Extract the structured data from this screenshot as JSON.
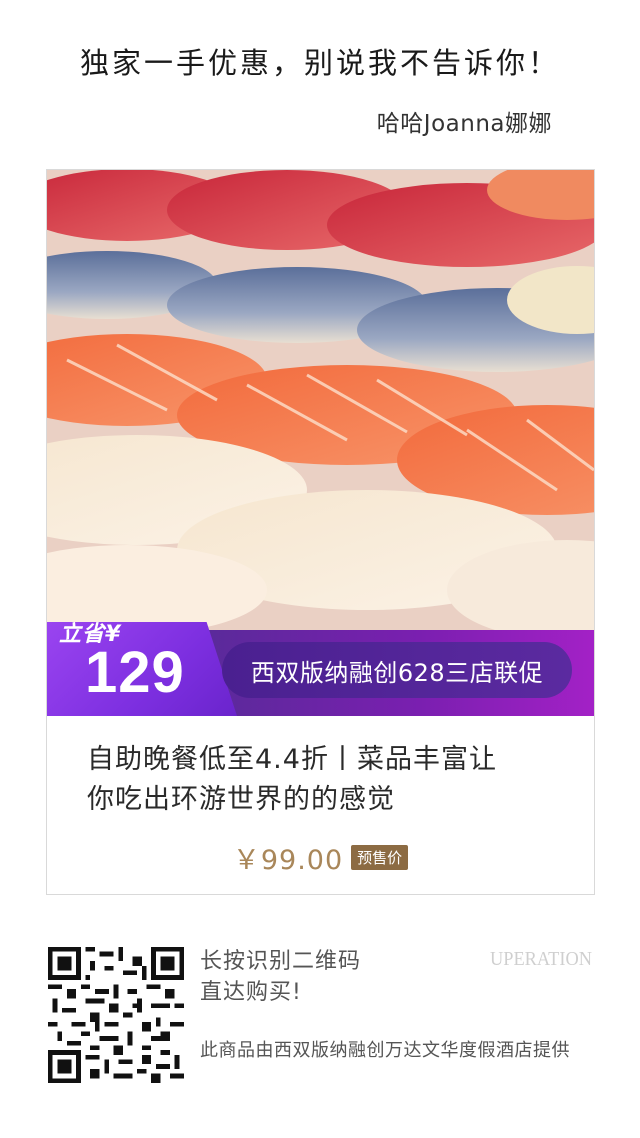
{
  "headline": "独家一手优惠，别说我不告诉你！",
  "author": "哈哈Joanna娜娜",
  "promo": {
    "save_label": "立省¥",
    "save_amount": "129",
    "title": "西双版纳融创628三店联促"
  },
  "product": {
    "title_line1": "自助晚餐低至4.4折丨菜品丰富让",
    "title_line2": "你吃出环游世界的的感觉",
    "price": "￥99.00",
    "presale_badge": "预售价"
  },
  "footer": {
    "scan_hint_line1": "长按识别二维码",
    "scan_hint_line2": "直达购买!",
    "brand_mark": "UPERATION",
    "provider": "此商品由西双版纳融创万达文华度假酒店提供"
  },
  "colors": {
    "promo_purple": "#7a1fb0",
    "price_gold": "#a9875a",
    "badge_brown": "#8c6b43"
  }
}
